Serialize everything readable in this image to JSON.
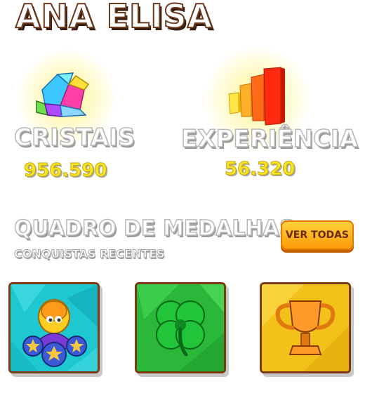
{
  "player": {
    "name": "ANA ELISA"
  },
  "stats": [
    {
      "label": "CRISTAIS",
      "value": "956.590",
      "icon": "crystal-icon"
    },
    {
      "label": "EXPERIÊNCIA",
      "value": "56.320",
      "icon": "experience-bars-icon"
    }
  ],
  "medals_section": {
    "title": "QUADRO DE MEDALHAS",
    "subtitle": "CONQUISTAS RECENTES",
    "see_all_label": "VER TODAS"
  },
  "medals": [
    {
      "icon": "character-stars-medal-icon",
      "color": "#1ec8d0"
    },
    {
      "icon": "four-leaf-clover-icon",
      "color": "#2bb83a"
    },
    {
      "icon": "trophy-icon",
      "color": "#f2c21a"
    }
  ]
}
